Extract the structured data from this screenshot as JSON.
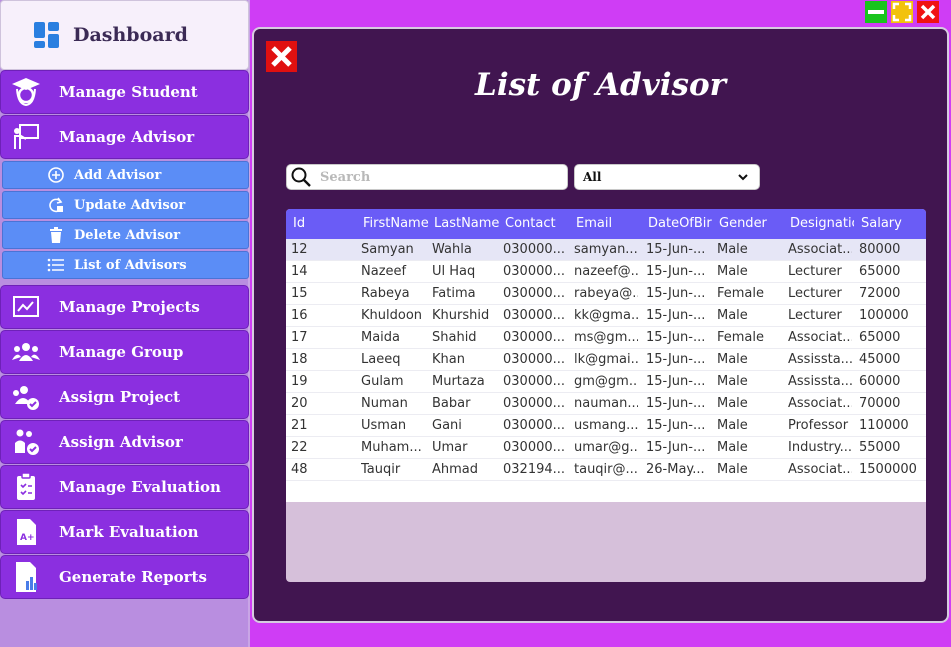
{
  "sidebar": {
    "title": "Dashboard",
    "items": [
      {
        "label": "Manage Student",
        "icon": "graduate-icon"
      },
      {
        "label": "Manage Advisor",
        "icon": "teacher-board-icon"
      },
      {
        "label": "Manage Projects",
        "icon": "chart-board-icon"
      },
      {
        "label": "Manage Group",
        "icon": "group-icon"
      },
      {
        "label": "Assign Project",
        "icon": "group-check-icon"
      },
      {
        "label": "Assign Advisor",
        "icon": "person-check-icon"
      },
      {
        "label": "Manage Evaluation",
        "icon": "clipboard-icon"
      },
      {
        "label": "Mark Evaluation",
        "icon": "grade-document-icon"
      },
      {
        "label": "Generate Reports",
        "icon": "report-icon"
      }
    ],
    "advisor_submenu": [
      {
        "label": "Add Advisor",
        "icon": "plus-circle-icon"
      },
      {
        "label": "Update Advisor",
        "icon": "refresh-icon"
      },
      {
        "label": "Delete Advisor",
        "icon": "trash-icon"
      },
      {
        "label": "List of Advisors",
        "icon": "list-icon"
      }
    ]
  },
  "window_controls": {
    "minimize": "minimize-icon",
    "maximize": "maximize-icon",
    "close": "close-icon"
  },
  "main": {
    "title": "List of Advisor",
    "search_placeholder": "Search",
    "filter_value": "All"
  },
  "table": {
    "columns": [
      "Id",
      "FirstName",
      "LastName",
      "Contact",
      "Email",
      "DateOfBirt",
      "Gender",
      "Designatic",
      "Salary"
    ],
    "rows": [
      [
        "12",
        "Samyan",
        "Wahla",
        "030000...",
        "samyan...",
        "15-Jun-...",
        "Male",
        "Associat...",
        "80000"
      ],
      [
        "14",
        "Nazeef",
        "Ul Haq",
        "030000...",
        "nazeef@...",
        "15-Jun-...",
        "Male",
        "Lecturer",
        "65000"
      ],
      [
        "15",
        "Rabeya",
        "Fatima",
        "030000...",
        "rabeya@...",
        "15-Jun-...",
        "Female",
        "Lecturer",
        "72000"
      ],
      [
        "16",
        "Khuldoon",
        "Khurshid",
        "030000...",
        "kk@gma...",
        "15-Jun-...",
        "Male",
        "Lecturer",
        "100000"
      ],
      [
        "17",
        "Maida",
        "Shahid",
        "030000...",
        "ms@gm...",
        "15-Jun-...",
        "Female",
        "Associat...",
        "65000"
      ],
      [
        "18",
        "Laeeq",
        "Khan",
        "030000...",
        "lk@gmai...",
        "15-Jun-...",
        "Male",
        "Assissta...",
        "45000"
      ],
      [
        "19",
        "Gulam",
        "Murtaza",
        "030000...",
        "gm@gm...",
        "15-Jun-...",
        "Male",
        "Assissta...",
        "60000"
      ],
      [
        "20",
        "Numan",
        "Babar",
        "030000...",
        "nauman...",
        "15-Jun-...",
        "Male",
        "Associat...",
        "70000"
      ],
      [
        "21",
        "Usman",
        "Gani",
        "030000...",
        "usmang...",
        "15-Jun-...",
        "Male",
        "Professor",
        "110000"
      ],
      [
        "22",
        "Muham...",
        "Umar",
        "030000...",
        "umar@g...",
        "15-Jun-...",
        "Male",
        "Industry...",
        "55000"
      ],
      [
        "48",
        "Tauqir",
        "Ahmad",
        "032194...",
        "tauqir@...",
        "26-May...",
        "Male",
        "Associat...",
        "1500000"
      ]
    ]
  },
  "colors": {
    "nav_bg": "#8b2fe0",
    "submenu_bg": "#5b8df6",
    "main_bg": "#411550",
    "header_bg": "#6a5cf6",
    "outer_bg": "#cf3df5"
  }
}
